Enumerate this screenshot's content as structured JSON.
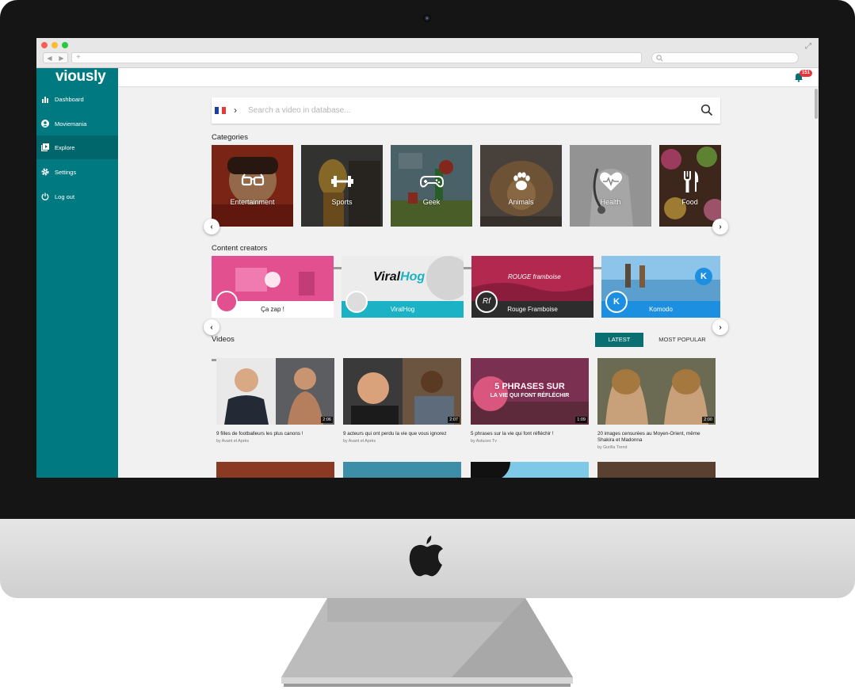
{
  "app": {
    "logo": "viously"
  },
  "browser": {
    "new_tab": "+"
  },
  "sidebar": {
    "items": [
      {
        "label": "Dashboard",
        "icon": "bar-chart-icon"
      },
      {
        "label": "Moviemania",
        "icon": "user-circle-icon"
      },
      {
        "label": "Explore",
        "icon": "video-library-icon",
        "active": true
      },
      {
        "label": "Settings",
        "icon": "gear-icon"
      },
      {
        "label": "Log out",
        "icon": "power-icon"
      }
    ]
  },
  "header": {
    "notification_count": "151"
  },
  "search": {
    "placeholder": "Search a video in database...",
    "country": "France"
  },
  "categories": {
    "title": "Categories",
    "items": [
      {
        "label": "Entertainment",
        "icon": "3d-glasses-icon",
        "color": "#b3351f"
      },
      {
        "label": "Sports",
        "icon": "dumbbell-icon",
        "color": "#6a5430"
      },
      {
        "label": "Geek",
        "icon": "gamepad-icon",
        "color": "#5d7d88"
      },
      {
        "label": "Animals",
        "icon": "paw-icon",
        "color": "#7d6048"
      },
      {
        "label": "Health",
        "icon": "heart-pulse-icon",
        "color": "#9a9a9a"
      },
      {
        "label": "Food",
        "icon": "fork-knife-icon",
        "color": "#7a4a36"
      }
    ]
  },
  "creators": {
    "title": "Content creators",
    "items": [
      {
        "name": "Ça zap !",
        "bar_color": "#ffffff",
        "banner_color": "#e2508f"
      },
      {
        "name": "ViralHog",
        "bar_color": "#1ab2c4",
        "banner_color": "#e8e8e8",
        "logo_text_a": "Viral",
        "logo_text_b": "Hog"
      },
      {
        "name": "Rouge Framboise",
        "bar_color": "#2d2d2d",
        "banner_color": "#b3284f",
        "logo_text": "ROUGE framboise",
        "avatar_text": "Rf"
      },
      {
        "name": "Komodo",
        "bar_color": "#1d8fe0",
        "banner_color": "#5fa6d6",
        "avatar_text": "K"
      }
    ]
  },
  "videos": {
    "title": "Videos",
    "tabs": {
      "latest": "LATEST",
      "popular": "MOST POPULAR"
    },
    "items": [
      {
        "title": "9 filles de footballeurs les plus canons !",
        "by": "by Avant et Après",
        "duration": "2:06"
      },
      {
        "title": "9 acteurs qui ont perdu la vie que vous ignorez",
        "by": "by Avant et Après",
        "duration": "2:07"
      },
      {
        "title": "5 phrases sur la vie qui font réfléchir !",
        "by": "by Astuces Tv",
        "duration": "1:09",
        "overlay_line1": "5 PHRASES SUR",
        "overlay_line2": "LA VIE QUI FONT RÉFLÉCHIR"
      },
      {
        "title": "20 images censurées au Moyen-Orient, même Shakira et Madonna",
        "by": "by Gorilla Trend",
        "duration": "2:00"
      }
    ]
  }
}
